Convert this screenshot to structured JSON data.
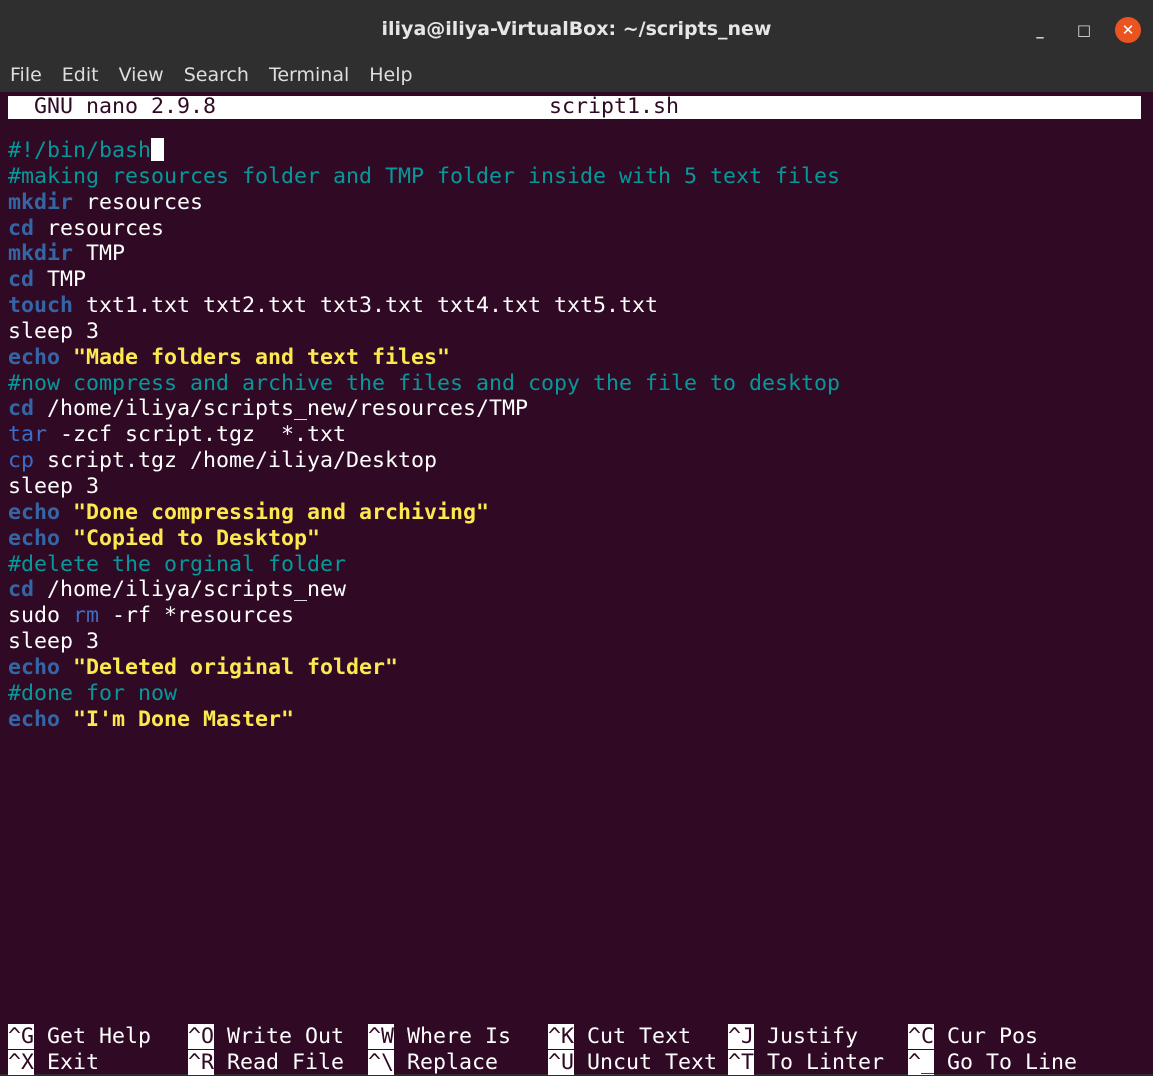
{
  "window": {
    "title": "iliya@iliya-VirtualBox: ~/scripts_new",
    "minimize_glyph": "_",
    "maximize_glyph": "□",
    "close_glyph": "✕"
  },
  "menu": [
    "File",
    "Edit",
    "View",
    "Search",
    "Terminal",
    "Help"
  ],
  "nano": {
    "version": "GNU nano 2.9.8",
    "filename": "script1.sh"
  },
  "code_lines": [
    [
      {
        "t": "#!/bin/bash",
        "c": "c-comment"
      },
      {
        "t": "",
        "c": "cursor"
      }
    ],
    [
      {
        "t": "#making resources folder and TMP folder inside with 5 text files",
        "c": "c-comment"
      }
    ],
    [
      {
        "t": "mkdir",
        "c": "c-kw"
      },
      {
        "t": " resources",
        "c": ""
      }
    ],
    [
      {
        "t": "cd",
        "c": "c-kw"
      },
      {
        "t": " resources",
        "c": ""
      }
    ],
    [
      {
        "t": "mkdir",
        "c": "c-kw"
      },
      {
        "t": " TMP",
        "c": ""
      }
    ],
    [
      {
        "t": "cd",
        "c": "c-kw"
      },
      {
        "t": " TMP",
        "c": ""
      }
    ],
    [
      {
        "t": "touch",
        "c": "c-kw"
      },
      {
        "t": " txt1.txt txt2.txt txt3.txt txt4.txt txt5.txt",
        "c": ""
      }
    ],
    [
      {
        "t": "sleep 3",
        "c": ""
      }
    ],
    [
      {
        "t": "echo",
        "c": "c-kw"
      },
      {
        "t": " ",
        "c": ""
      },
      {
        "t": "\"Made folders and text files\"",
        "c": "c-str"
      }
    ],
    [
      {
        "t": "#now compress and archive the files and copy the file to desktop",
        "c": "c-comment"
      }
    ],
    [
      {
        "t": "cd",
        "c": "c-kw"
      },
      {
        "t": " /home/iliya/scripts_new/resources/TMP",
        "c": ""
      }
    ],
    [
      {
        "t": "tar",
        "c": "c-kw2"
      },
      {
        "t": " -zcf script.tgz  *.txt",
        "c": ""
      }
    ],
    [
      {
        "t": "cp",
        "c": "c-kw2"
      },
      {
        "t": " script.tgz /home/iliya/Desktop",
        "c": ""
      }
    ],
    [
      {
        "t": "sleep 3",
        "c": ""
      }
    ],
    [
      {
        "t": "echo",
        "c": "c-kw"
      },
      {
        "t": " ",
        "c": ""
      },
      {
        "t": "\"Done compressing and archiving\"",
        "c": "c-str"
      }
    ],
    [
      {
        "t": "echo",
        "c": "c-kw"
      },
      {
        "t": " ",
        "c": ""
      },
      {
        "t": "\"Copied to Desktop\"",
        "c": "c-str"
      }
    ],
    [
      {
        "t": "#delete the orginal folder",
        "c": "c-comment"
      }
    ],
    [
      {
        "t": "cd",
        "c": "c-kw"
      },
      {
        "t": " /home/iliya/scripts_new",
        "c": ""
      }
    ],
    [
      {
        "t": "sudo ",
        "c": ""
      },
      {
        "t": "rm",
        "c": "c-kw2"
      },
      {
        "t": " -rf *resources",
        "c": ""
      }
    ],
    [
      {
        "t": "sleep 3",
        "c": ""
      }
    ],
    [
      {
        "t": "echo",
        "c": "c-kw"
      },
      {
        "t": " ",
        "c": ""
      },
      {
        "t": "\"Deleted original folder\"",
        "c": "c-str"
      }
    ],
    [
      {
        "t": "#done for now",
        "c": "c-comment"
      }
    ],
    [
      {
        "t": "echo",
        "c": "c-kw"
      },
      {
        "t": " ",
        "c": ""
      },
      {
        "t": "\"I'm Done Master\"",
        "c": "c-str"
      }
    ]
  ],
  "shortcuts": [
    [
      {
        "key": "^G",
        "label": "Get Help",
        "name": "get-help"
      },
      {
        "key": "^O",
        "label": "Write Out",
        "name": "write-out"
      },
      {
        "key": "^W",
        "label": "Where Is",
        "name": "where-is"
      },
      {
        "key": "^K",
        "label": "Cut Text",
        "name": "cut-text"
      },
      {
        "key": "^J",
        "label": "Justify",
        "name": "justify"
      },
      {
        "key": "^C",
        "label": "Cur Pos",
        "name": "cur-pos"
      }
    ],
    [
      {
        "key": "^X",
        "label": "Exit",
        "name": "exit"
      },
      {
        "key": "^R",
        "label": "Read File",
        "name": "read-file"
      },
      {
        "key": "^\\",
        "label": "Replace",
        "name": "replace"
      },
      {
        "key": "^U",
        "label": "Uncut Text",
        "name": "uncut-text"
      },
      {
        "key": "^T",
        "label": "To Linter",
        "name": "to-linter"
      },
      {
        "key": "^_",
        "label": "Go To Line",
        "name": "go-to-line"
      }
    ]
  ]
}
